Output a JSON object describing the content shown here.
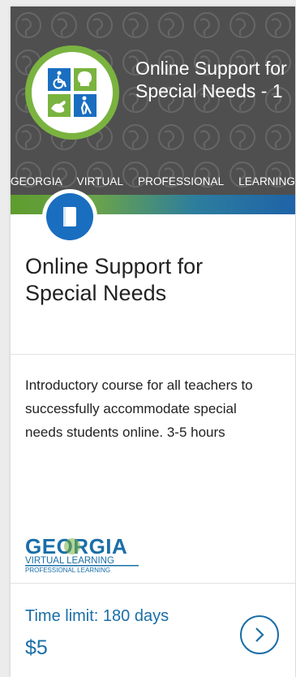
{
  "banner": {
    "title": "Online Support for Special Needs - 1",
    "footer_words": [
      "GEORGIA",
      "VIRTUAL",
      "PROFESSIONAL",
      "LEARNING"
    ]
  },
  "course": {
    "type_icon": "book-icon",
    "title": "Online Support for Special Needs",
    "description": "Introductory course for all teachers to successfully accommodate special needs students online. 3-5 hours"
  },
  "provider": {
    "line1": "GEORGIA",
    "line2": "VIRTUAL LEARNING",
    "line3": "PROFESSIONAL LEARNING"
  },
  "footer": {
    "time_limit": "Time limit: 180 days",
    "price": "$5",
    "go_icon": "chevron-right-icon"
  },
  "colors": {
    "accent": "#1a6ea8",
    "badge_blue": "#1a6ec0",
    "logo_green": "#7ab33f",
    "banner_gray": "#4f4f4f"
  }
}
